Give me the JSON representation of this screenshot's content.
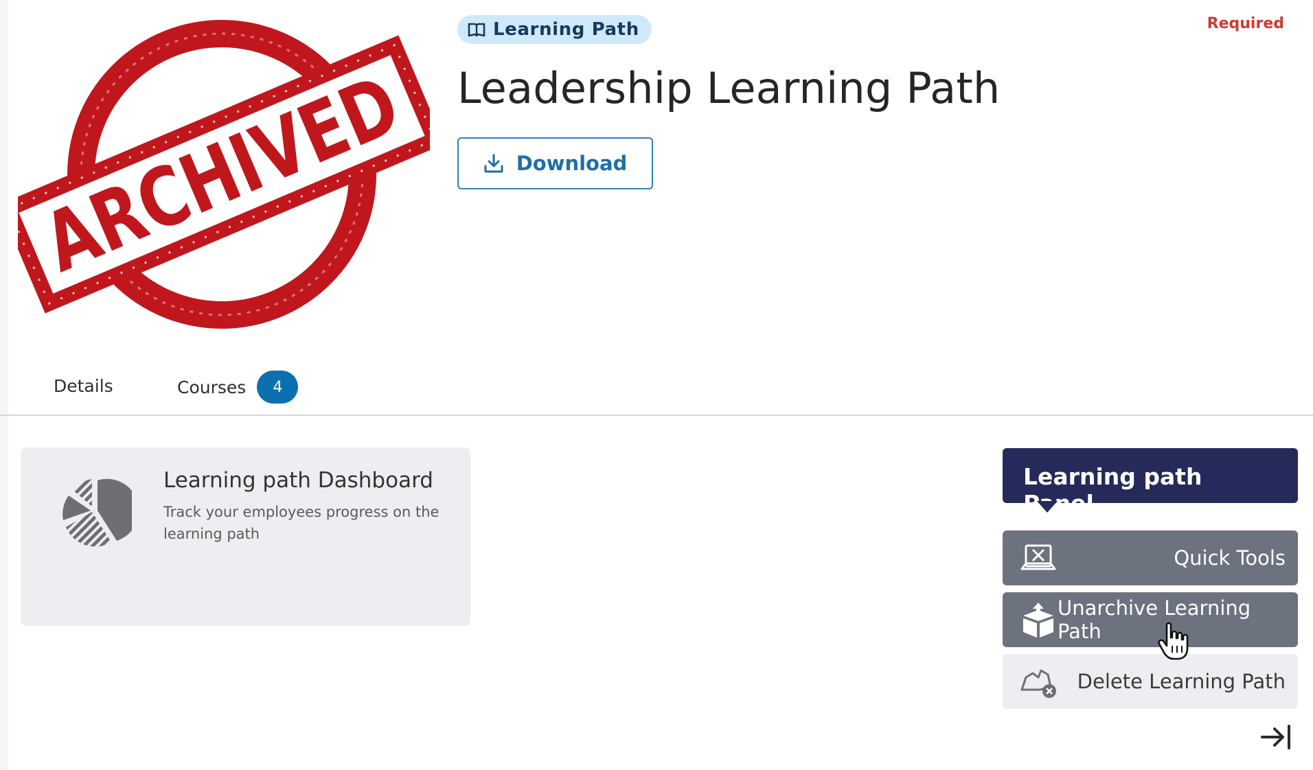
{
  "header": {
    "type_badge": "Learning Path",
    "required_label": "Required",
    "title": "Leadership Learning Path",
    "download_label": "Download",
    "cover_stamp_text": "ARCHIVED"
  },
  "tabs": [
    {
      "label": "Details"
    },
    {
      "label": "Courses",
      "count": "4"
    }
  ],
  "dashboard_card": {
    "title": "Learning path Dashboard",
    "description": "Track your employees progress on the learning path",
    "icon": "pie-chart-icon"
  },
  "panel": {
    "title": "Learning path Panel",
    "buttons": [
      {
        "label": "Quick Tools",
        "icon": "quick-tools-icon"
      },
      {
        "label": "Unarchive Learning Path",
        "icon": "unarchive-box-icon"
      },
      {
        "label": "Delete Learning Path",
        "icon": "delete-path-icon"
      }
    ]
  },
  "colors": {
    "accent_blue": "#0b6fb0",
    "panel_navy": "#252a5a",
    "stamp_red": "#c0171d",
    "required_red": "#cc3b33"
  }
}
